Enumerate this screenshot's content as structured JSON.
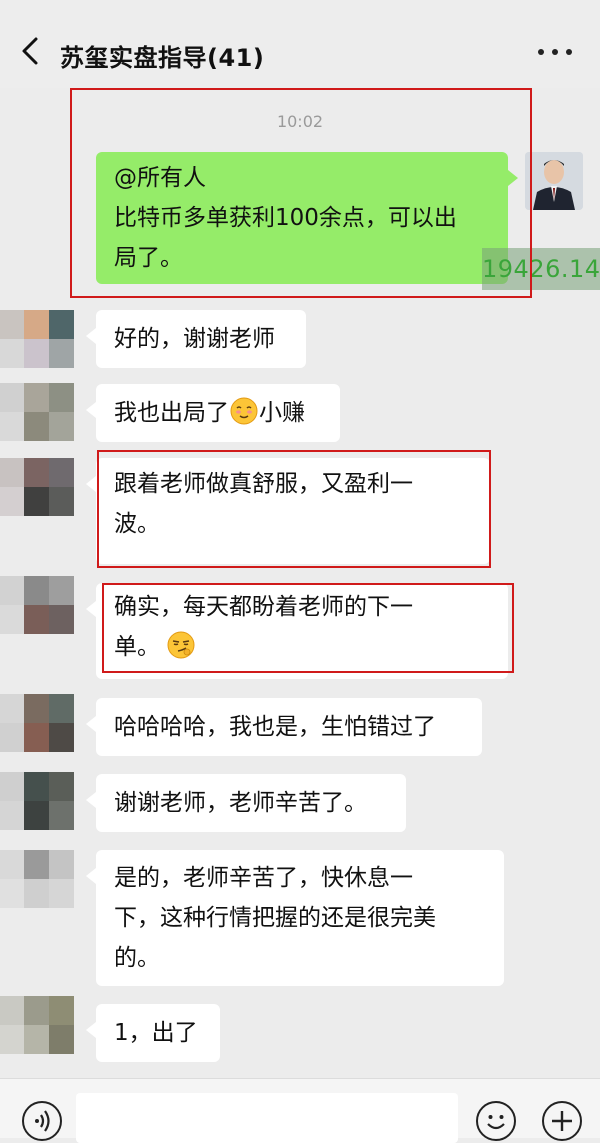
{
  "header": {
    "title": "苏玺实盘指导(41)",
    "back_icon": "back-chevron-icon",
    "more_icon": "more-dots-icon"
  },
  "chat": {
    "timestamp": "10:02",
    "outgoing": {
      "line1": "@所有人",
      "line2": "比特币多单获利100余点，可以出",
      "line3": "局了。"
    },
    "watermark": "19426.14",
    "messages": [
      {
        "text": "好的，谢谢老师"
      },
      {
        "text_before": "我也出局了",
        "emoji": "smile-emoji",
        "text_after": "小赚"
      },
      {
        "line1": "跟着老师做真舒服，又盈利一",
        "line2": "波。"
      },
      {
        "line1": "确实，每天都盼着老师的下一",
        "line2_text": "单。",
        "emoji": "smirk-emoji"
      },
      {
        "text": "哈哈哈哈，我也是，生怕错过了"
      },
      {
        "text": "谢谢老师，老师辛苦了。"
      },
      {
        "line1": "是的，老师辛苦了，快休息一",
        "line2": "下，这种行情把握的还是很完美",
        "line3": "的。"
      },
      {
        "text": "1，出了"
      }
    ]
  },
  "input_bar": {
    "voice_icon": "voice-icon",
    "emoji_icon": "emoji-icon",
    "add_icon": "add-icon"
  },
  "colors": {
    "outgoing_bubble": "#95ec69",
    "incoming_bubble": "#ffffff",
    "highlight": "#d01a1a",
    "background": "#ececec"
  }
}
